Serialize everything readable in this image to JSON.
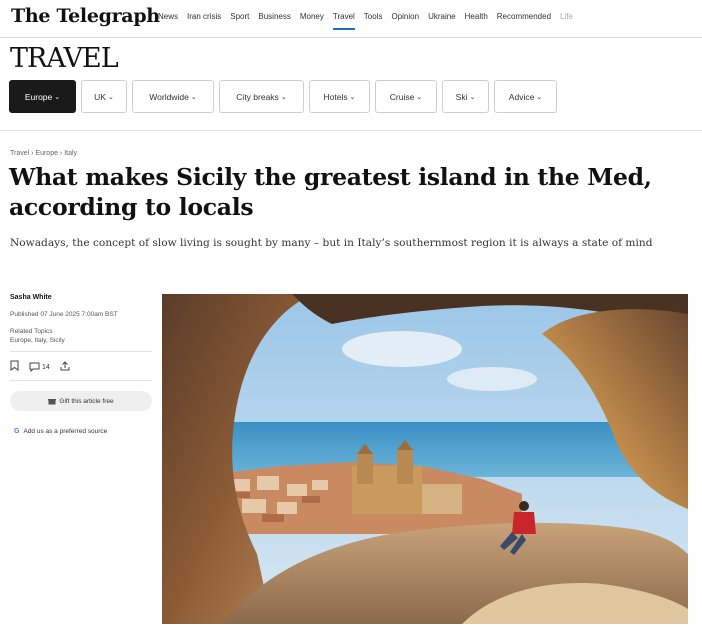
{
  "masthead": {
    "logo": "The Telegraph"
  },
  "topnav": [
    "News",
    "Iran crisis",
    "Sport",
    "Business",
    "Money",
    "Travel",
    "Tools",
    "Opinion",
    "Ukraine",
    "Health",
    "Recommended",
    "Life"
  ],
  "section": {
    "title": "TRAVEL"
  },
  "subnav": [
    {
      "label": "Europe",
      "active": true
    },
    {
      "label": "UK",
      "active": false
    },
    {
      "label": "Worldwide",
      "active": false
    },
    {
      "label": "City breaks",
      "active": false
    },
    {
      "label": "Hotels",
      "active": false
    },
    {
      "label": "Cruise",
      "active": false
    },
    {
      "label": "Ski",
      "active": false
    },
    {
      "label": "Advice",
      "active": false
    }
  ],
  "article": {
    "breadcrumb": "Travel › Europe › Italy",
    "headline": "What makes Sicily the greatest island in the Med, according to locals",
    "standfirst": "Nowadays, the concept of slow living is sought by many – but in Italy’s southernmost region it is always a state of mind",
    "author": "Sasha White",
    "published": "Published 07 June 2025 7:00am BST",
    "related_label": "Related Topics",
    "related_topics": "Europe, Italy, Sicily",
    "comment_count": "14",
    "gift_label": "Gift this article free",
    "preferred_label": "Add us as a preferred source"
  },
  "colors": {
    "accent": "#1f6fbf",
    "pill_active": "#1a1a1a"
  },
  "icons": [
    "bookmark-icon",
    "comment-icon",
    "share-icon",
    "gift-icon",
    "google-icon"
  ]
}
